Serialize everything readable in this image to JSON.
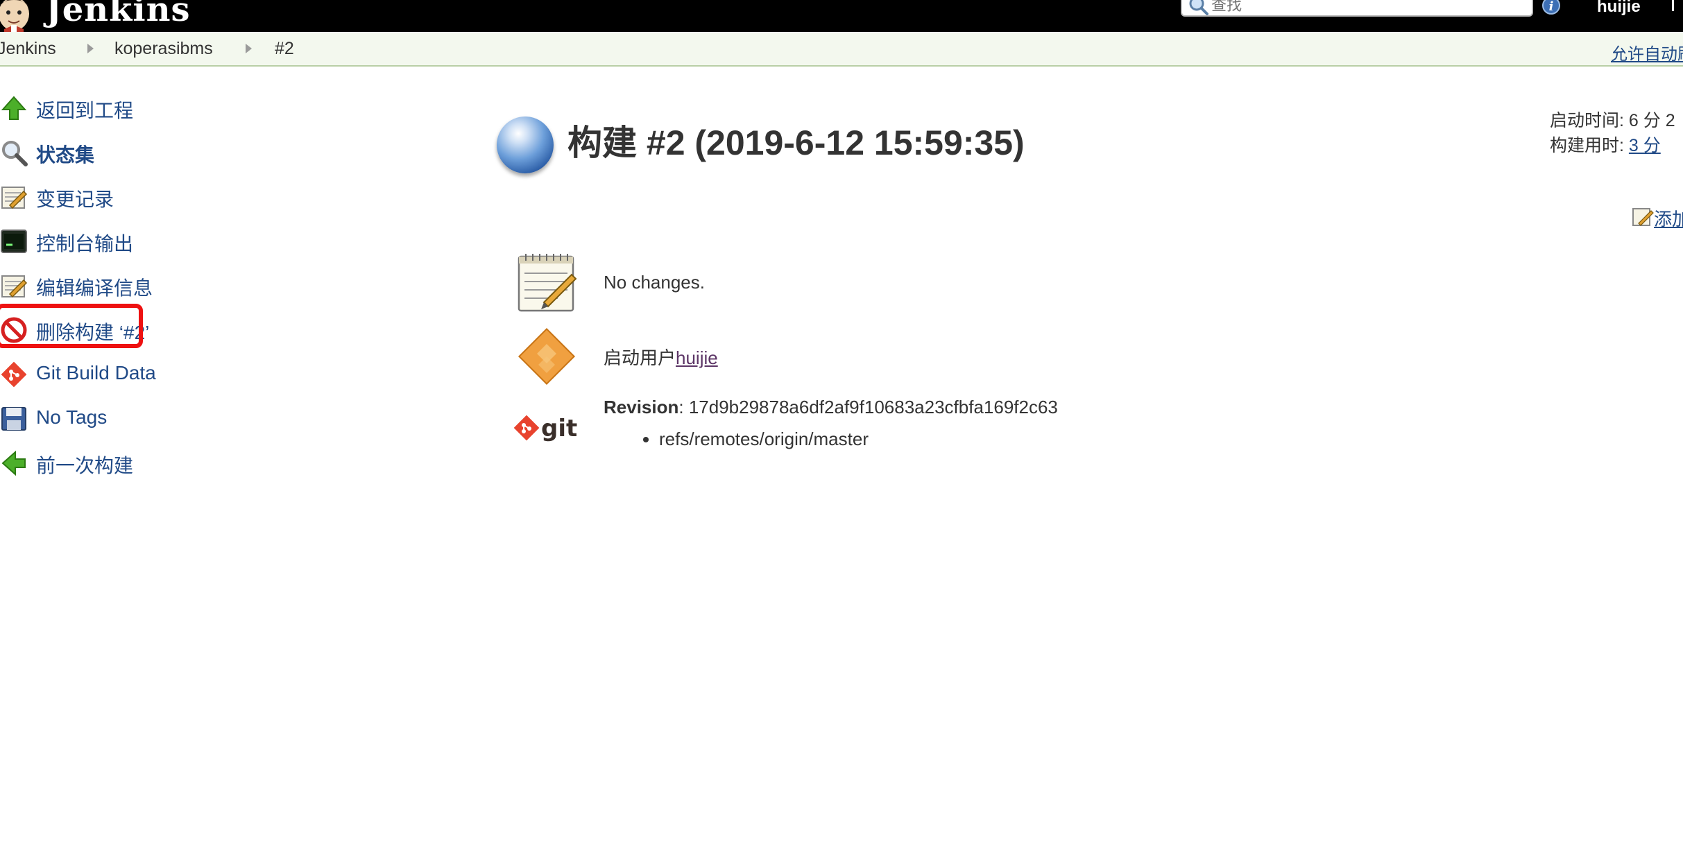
{
  "header": {
    "logo_text": "Jenkins",
    "search_placeholder": "查找",
    "user_name": "huijie",
    "accent_color": "#000000"
  },
  "breadcrumb": {
    "items": [
      "Jenkins",
      "koperasibms",
      "#2"
    ],
    "right_link": "允许自动刷"
  },
  "side_panel": {
    "tasks": [
      {
        "label": "返回到工程",
        "icon": "up-arrow-icon"
      },
      {
        "label": "状态集",
        "icon": "magnifier-icon"
      },
      {
        "label": "变更记录",
        "icon": "notepad-icon"
      },
      {
        "label": "控制台输出",
        "icon": "terminal-icon"
      },
      {
        "label": "编辑编译信息",
        "icon": "notepad-icon"
      },
      {
        "label": "删除构建 ‘#2’",
        "icon": "no-entry-icon"
      },
      {
        "label": "Git Build Data",
        "icon": "git-icon"
      },
      {
        "label": "No Tags",
        "icon": "save-icon"
      },
      {
        "label": "前一次构建",
        "icon": "left-arrow-icon"
      }
    ],
    "highlighted_task": "控制台输出",
    "highlight_color": "#ee1111"
  },
  "main": {
    "title": "构建 #2 (2019-6-12 15:59:35)",
    "start_time_label": "启动时间:",
    "start_time_value": "6 分 2",
    "duration_label": "构建用时:",
    "duration_value": "3 分",
    "add_description": "添加",
    "changes_text": "No changes.",
    "started_by_prefix": "启动用户",
    "started_by_user": "huijie",
    "revision_label": "Revision",
    "revision_value": ": 17d9b29878a6df2af9f10683a23cfbfa169f2c63",
    "branches": [
      "refs/remotes/origin/master"
    ],
    "git_logo_text": "git",
    "status_color": "#3b6db3"
  }
}
